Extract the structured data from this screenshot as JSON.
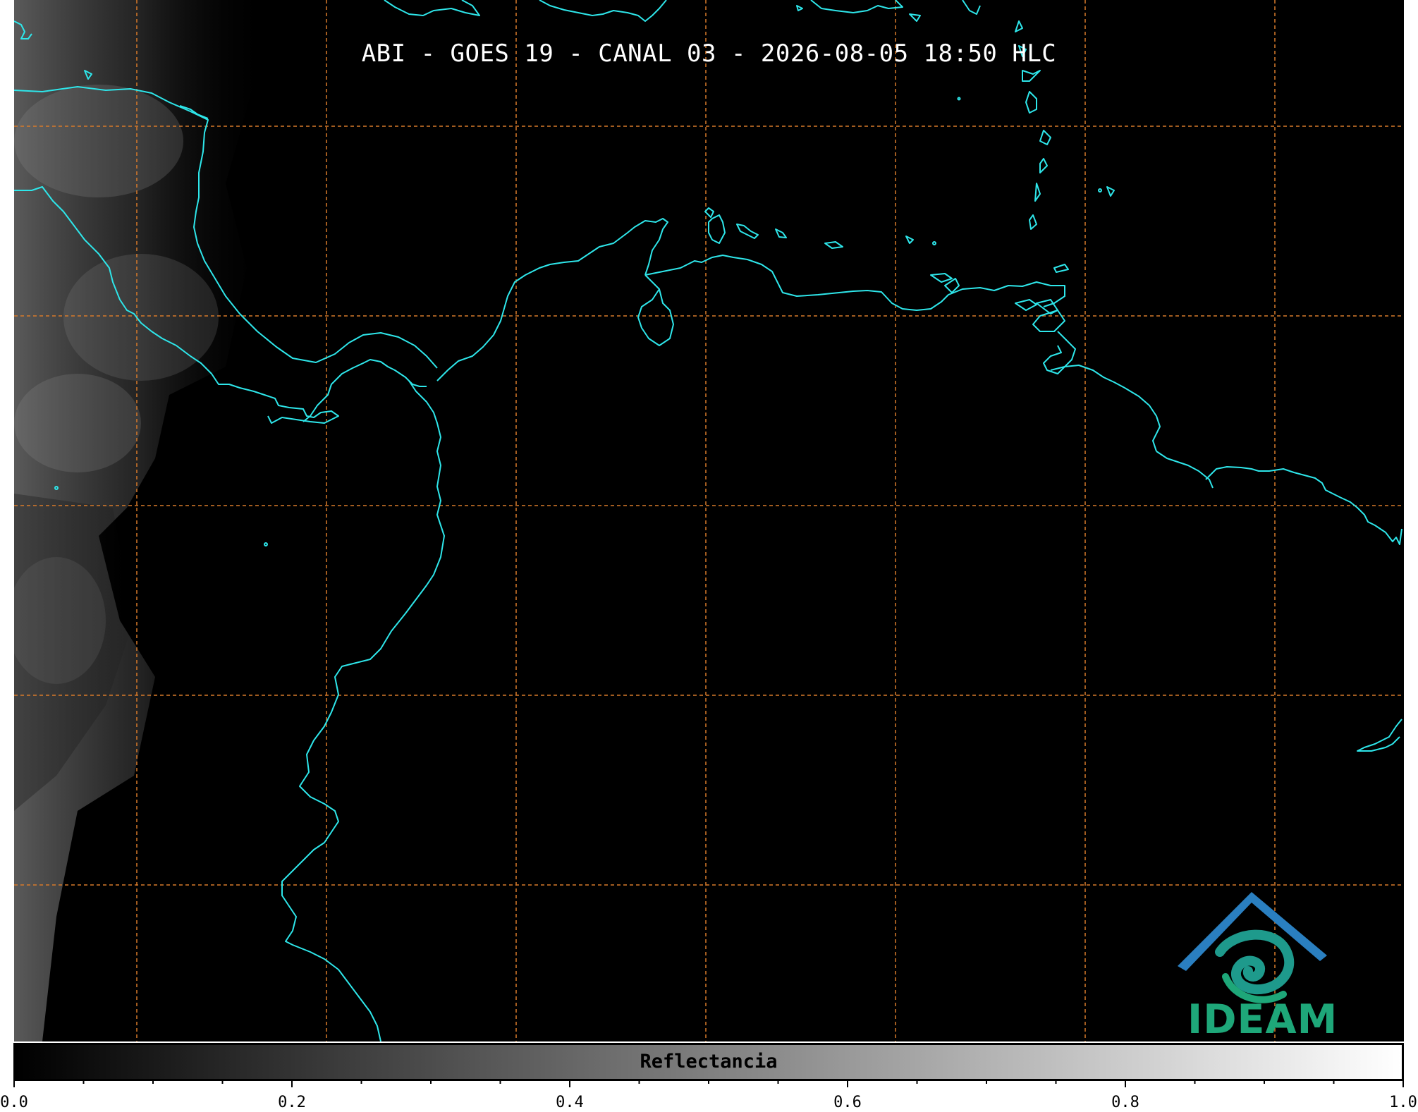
{
  "title": "ABI - GOES 19 - CANAL 03 - 2026-08-05 18:50 HLC",
  "colors": {
    "coastline": "#2ee6ea",
    "gridline": "#d87a2a",
    "background": "#000000",
    "logo_blue": "#2a7fc0",
    "logo_green": "#1ea779"
  },
  "logo": {
    "text": "IDEAM",
    "icon": "ideam-mountain-spiral-logo"
  },
  "colorbar": {
    "label": "Reflectancia",
    "range": [
      0.0,
      1.0
    ],
    "colormap": "grayscale black-to-white",
    "tick_labels": [
      "0.0",
      "0.2",
      "0.4",
      "0.6",
      "0.8",
      "1.0"
    ]
  }
}
